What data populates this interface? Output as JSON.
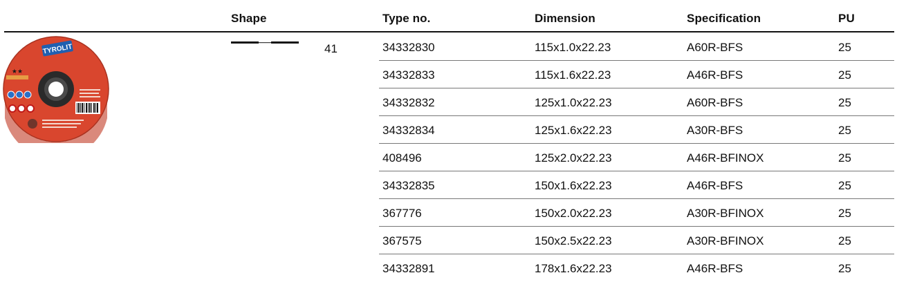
{
  "columns": {
    "shape": "Shape",
    "type_no": "Type no.",
    "dimension": "Dimension",
    "specification": "Specification",
    "pu": "PU"
  },
  "product_image": {
    "brand": "TYROLIT",
    "stars": "★★",
    "colors": {
      "disc": "#d9462e",
      "center": "#2a2a2a",
      "band": "#b22a1e",
      "brand_plate": "#1f5fb0"
    }
  },
  "shape": {
    "value": "41",
    "icon": "flat-disc-icon"
  },
  "rows": [
    {
      "type_no": "34332830",
      "dimension": "115x1.0x22.23",
      "specification": "A60R-BFS",
      "pu": "25"
    },
    {
      "type_no": "34332833",
      "dimension": "115x1.6x22.23",
      "specification": "A46R-BFS",
      "pu": "25"
    },
    {
      "type_no": "34332832",
      "dimension": "125x1.0x22.23",
      "specification": "A60R-BFS",
      "pu": "25"
    },
    {
      "type_no": "34332834",
      "dimension": "125x1.6x22.23",
      "specification": "A30R-BFS",
      "pu": "25"
    },
    {
      "type_no": "408496",
      "dimension": "125x2.0x22.23",
      "specification": "A46R-BFINOX",
      "pu": "25"
    },
    {
      "type_no": "34332835",
      "dimension": "150x1.6x22.23",
      "specification": "A46R-BFS",
      "pu": "25"
    },
    {
      "type_no": "367776",
      "dimension": "150x2.0x22.23",
      "specification": "A30R-BFINOX",
      "pu": "25"
    },
    {
      "type_no": "367575",
      "dimension": "150x2.5x22.23",
      "specification": "A30R-BFINOX",
      "pu": "25"
    },
    {
      "type_no": "34332891",
      "dimension": "178x1.6x22.23",
      "specification": "A46R-BFS",
      "pu": "25"
    }
  ]
}
